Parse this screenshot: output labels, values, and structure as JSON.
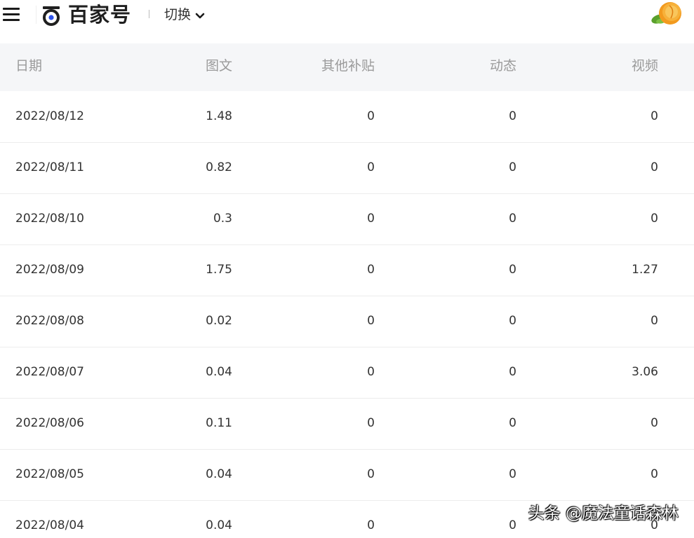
{
  "header": {
    "logo_text": "百家号",
    "switch_label": "切换"
  },
  "table": {
    "columns": [
      "日期",
      "图文",
      "其他补贴",
      "动态",
      "视频"
    ],
    "rows": [
      [
        "2022/08/12",
        "1.48",
        "0",
        "0",
        "0"
      ],
      [
        "2022/08/11",
        "0.82",
        "0",
        "0",
        "0"
      ],
      [
        "2022/08/10",
        "0.3",
        "0",
        "0",
        "0"
      ],
      [
        "2022/08/09",
        "1.75",
        "0",
        "0",
        "1.27"
      ],
      [
        "2022/08/08",
        "0.02",
        "0",
        "0",
        "0"
      ],
      [
        "2022/08/07",
        "0.04",
        "0",
        "0",
        "3.06"
      ],
      [
        "2022/08/06",
        "0.11",
        "0",
        "0",
        "0"
      ],
      [
        "2022/08/05",
        "0.04",
        "0",
        "0",
        "0"
      ],
      [
        "2022/08/04",
        "0.04",
        "0",
        "0",
        "0"
      ]
    ]
  },
  "watermark": "头条 @魔法童话森林",
  "icons": {
    "menu": "hamburger-icon",
    "logo": "baijiahao-logo-icon",
    "dropdown": "chevron-down-icon",
    "avatar": "orange-fruit-avatar"
  },
  "colors": {
    "header_bg": "#f5f6f8",
    "header_text": "#9a9a9a",
    "body_text": "#333333",
    "divider": "#ececec",
    "logo_blue": "#2f54eb"
  }
}
